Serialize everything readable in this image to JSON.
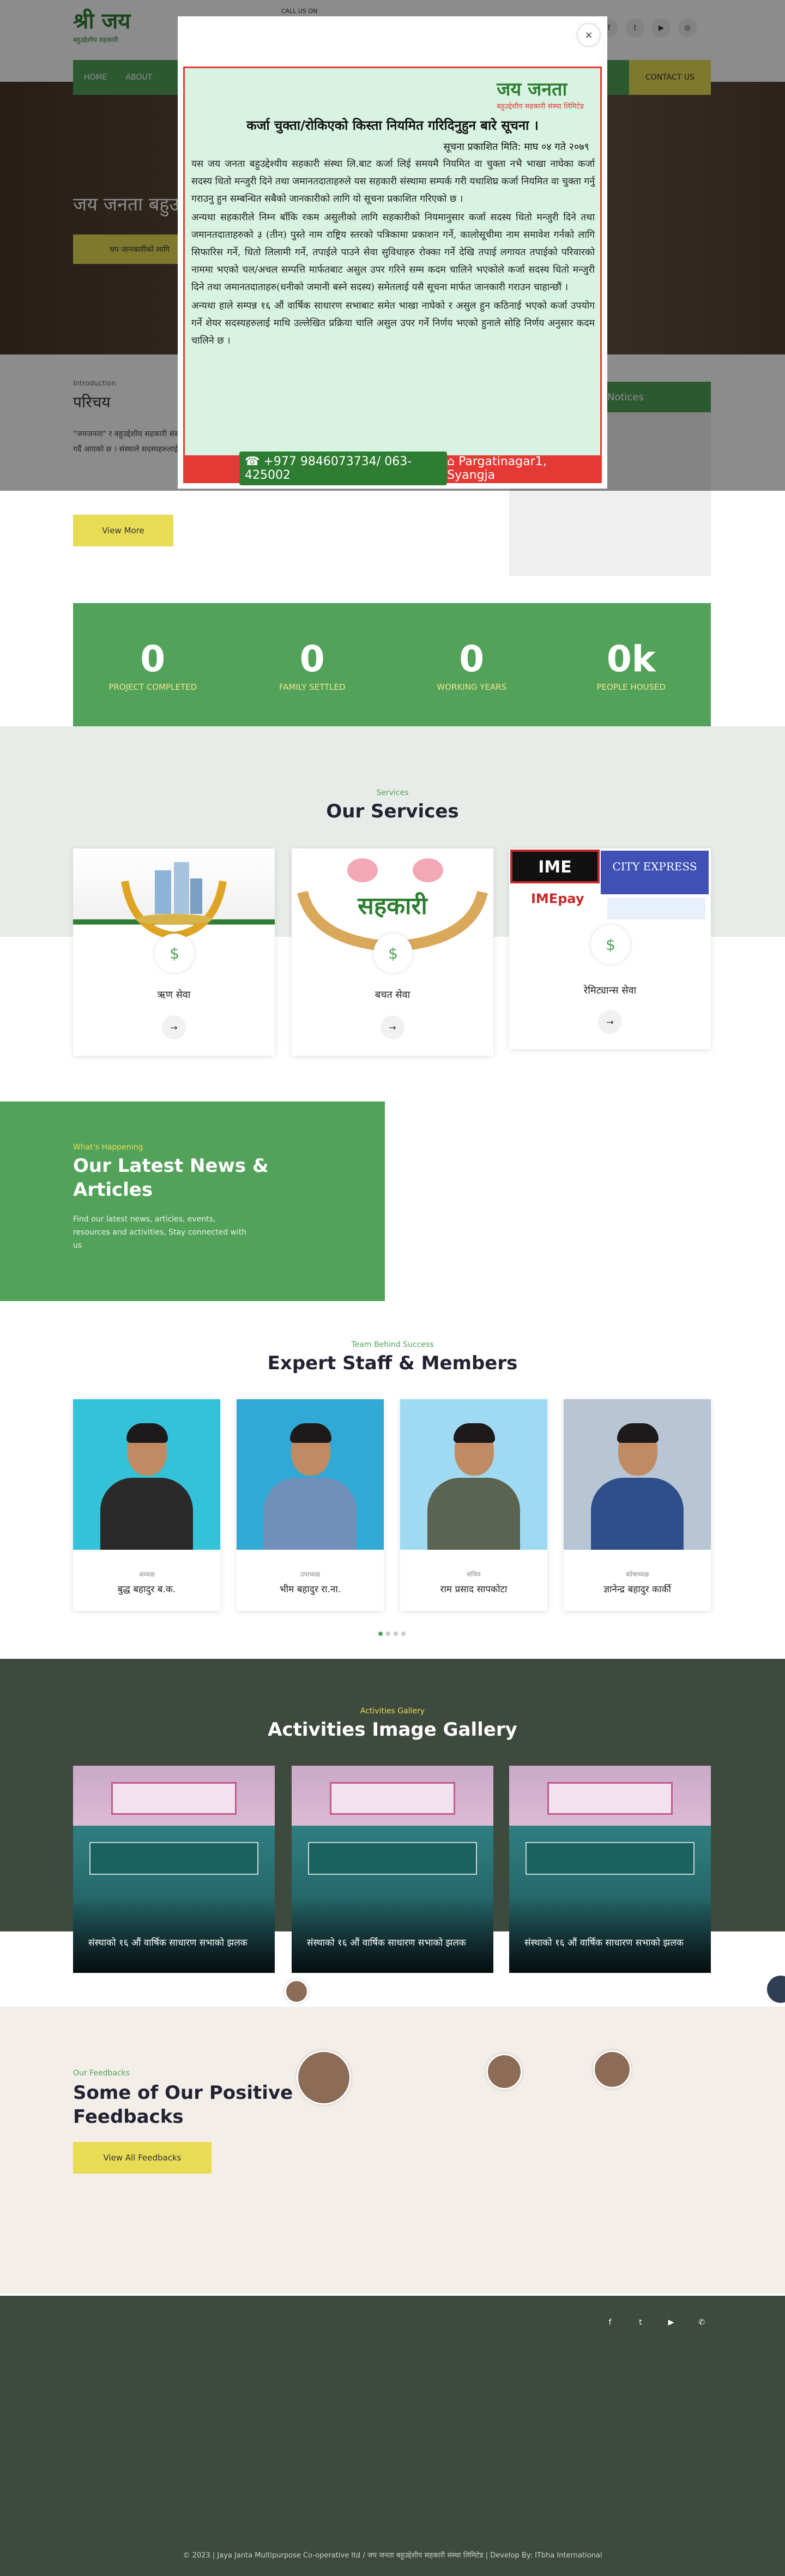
{
  "header": {
    "logo_line1": "श्री जय",
    "logo_line2": "बहुउद्देशीय सहकारी",
    "call_us": "CALL US ON",
    "nav": [
      "HOME",
      "ABOUT"
    ],
    "contact_button": "CONTACT US",
    "socials": [
      "facebook-icon",
      "twitter-icon",
      "youtube-icon",
      "instagram-icon"
    ]
  },
  "hero": {
    "title": "जय जनता बहुउद्देशीय",
    "button": "थप जानकारीको लागि"
  },
  "notice": {
    "close": "×",
    "logo_main": "जय जनता",
    "logo_sub": "बहुउद्देशीय सहकारी संस्था लिमिटेड",
    "title": "कर्जा चुक्ता/रोकिएको किस्ता नियमित गरिदिनुहुन बारे सूचना ।",
    "date": "सूचना प्रकाशित मिति: माघ ०४ गते २०७९",
    "para1": "यस जय जनता बहुउद्देश्यीय सहकारी संस्था लि.बाट कर्जा लिई समयमै नियमित वा चुक्ता नभै भाखा नाघेका कर्जा सदस्य धितो मन्जुरी दिने तथा जमानतदाताहरुले यस सहकारी संस्थामा सम्पर्क गरी यथाशिघ्र कर्जा नियमित वा चुक्ता गर्नु गराउनु हुन सम्बन्धित सबैको जानकारीको लागि यो सूचना प्रकाशित गरिएको छ ।",
    "para2": "अन्यथा सहकारीले निम्न बाँकि रकम असुलीको लागि सहकारीको नियमानुसार कर्जा सदस्य धितो मन्जुरी दिने तथा जमानतदाताहरुको ३ (तीन) पुस्ते नाम राष्ट्रिय स्तरको पत्रिकामा प्रकाशन गर्ने, कालोसूचीमा नाम समावेश गर्नको लागि सिफारिस गर्ने, धितो लिलामी गर्ने, तपाईले पाउने सेवा सुविधाहरु रोक्का गर्ने देखि तपाई लगायत तपाईको परिवारको नाममा भएको चल/अचल सम्पत्ति मार्फतबाट असुल उपर गरिने सम्म कदम चालिने भएकोले कर्जा सदस्य धितो मन्जुरी दिने तथा जमानतदाताहरु(धनीको जमानी बस्ने सदस्य) समेतलाई यसै सूचना मार्फत जानकारी गराउन चाहान्छौं ।",
    "para3": "अन्यथा हाले सम्पन्न १६ औं वार्षिक साधारण सभाबाट समेत भाखा नाघेको र असुल हुन कठिनाई भएको कर्जा उपयोग गर्ने शेयर सदस्यहरुलाई माथि उल्लेखित प्रक्रिया चालि असुल उपर गर्ने निर्णय भएको हुनाले सोहि निर्णय अनुसार कदम चालिने छ ।",
    "phone": "+977 9846073734/ 063-425002",
    "address": "Pargatinagar1, Syangja"
  },
  "intro": {
    "label": "Introduction",
    "title": "परिचय",
    "text": "\"जयजनता\" र बहुउद्देशीय सहकारी संस्था लिमिटेड संस्थाले आफ्ना सदस्य तथा समुदायको आर्थिक उन्नतिका लागि बचत तथा ऋणको प्रवाह गर्दै आएको छ । संस्थाले सदस्यहरुलाई सहुलियत दरमा ऋण तथा आकर्षक ब्याजदरमा बचत संकलन गर्ने उद्देश्य अनुसार काम गरिरहेको छ ।",
    "button": "View More"
  },
  "notices": {
    "title": "Notices"
  },
  "stats": [
    {
      "num": "0",
      "label": "PROJECT COMPLETED"
    },
    {
      "num": "0",
      "label": "FAMILY SETTLED"
    },
    {
      "num": "0",
      "label": "WORKING YEARS"
    },
    {
      "num": "0k",
      "label": "PEOPLE HOUSED"
    }
  ],
  "services": {
    "label": "Services",
    "title": "Our Services",
    "items": [
      {
        "name": "ऋण सेवा",
        "img_text": ""
      },
      {
        "name": "बचत सेवा",
        "img_text": "सहकारी"
      },
      {
        "name": "रेमिट्यान्स सेवा",
        "img_text": "IME · CITY EXPRESS · IMEpay"
      }
    ]
  },
  "news": {
    "label": "What's Happening",
    "title": "Our Latest News & Articles",
    "text": "Find our latest news, articles, events, resources and activities, Stay connected with us"
  },
  "staff": {
    "label": "Team Behind Success",
    "title": "Expert Staff & Members",
    "members": [
      {
        "role": "अध्यक्ष",
        "name": "बुद्ध बहादुर ब.क.",
        "bg": "#33c2d8",
        "suit": "#2a2a2a"
      },
      {
        "role": "उपाध्यक्ष",
        "name": "भीम बहादुर रा.ना.",
        "bg": "#31a9d6",
        "suit": "#6f8fb8"
      },
      {
        "role": "सचिव",
        "name": "राम प्रसाद सापकोटा",
        "bg": "#9fdaf2",
        "suit": "#5a6450"
      },
      {
        "role": "कोषाध्यक्ष",
        "name": "ज्ञानेन्द्र बहादुर कार्की",
        "bg": "#b7c5d5",
        "suit": "#2f4f8a"
      }
    ]
  },
  "gallery": {
    "label": "Activities Gallery",
    "title": "Activities Image Gallery",
    "items": [
      {
        "caption": "संस्थाको १६ औं वार्षिक साधारण सभाको झलक"
      },
      {
        "caption": "संस्थाको १६ औं वार्षिक साधारण सभाको झलक"
      },
      {
        "caption": "संस्थाको १६ औं वार्षिक साधारण सभाको झलक"
      }
    ]
  },
  "feedback": {
    "label": "Our Feedbacks",
    "title": "Some of Our Positive Feedbacks",
    "button": "View All Feedbacks"
  },
  "footer": {
    "socials": [
      "facebook-icon",
      "twitter-icon",
      "youtube-icon",
      "whatsapp-icon"
    ],
    "copyright": "© 2023 | Jaya Janta Multipurpose Co-operative ltd / जय जनता बहुउद्देशीय सहकारी संस्था लिमिटेड | Develop By: ITbha International"
  },
  "colors": {
    "green": "#53a25a",
    "yellow": "#e8dc55",
    "dark": "#3e4a3d"
  }
}
